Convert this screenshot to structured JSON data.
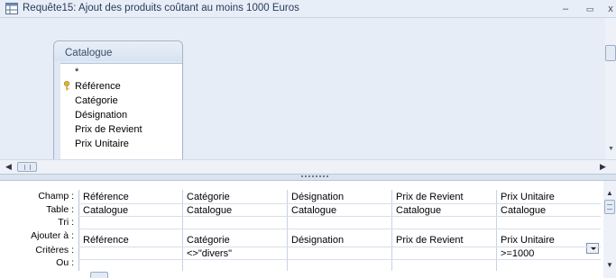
{
  "window": {
    "title": "Requête15: Ajout des produits coûtant au moins 1000 Euros",
    "minimize": "–",
    "restore": "▭",
    "close": "x"
  },
  "table_box": {
    "name": "Catalogue",
    "fields": [
      "*",
      "Référence",
      "Catégorie",
      "Désignation",
      "Prix de Revient",
      "Prix Unitaire"
    ],
    "key_field_index": 1
  },
  "grid": {
    "row_labels": [
      "Champ :",
      "Table :",
      "Tri :",
      "Ajouter à :",
      "Critères :",
      "Ou :"
    ],
    "columns": [
      {
        "champ": "Référence",
        "table": "Catalogue",
        "tri": "",
        "ajouter": "Référence",
        "criteres": "",
        "ou": ""
      },
      {
        "champ": "Catégorie",
        "table": "Catalogue",
        "tri": "",
        "ajouter": "Catégorie",
        "criteres": "<>\"divers\"",
        "ou": ""
      },
      {
        "champ": "Désignation",
        "table": "Catalogue",
        "tri": "",
        "ajouter": "Désignation",
        "criteres": "",
        "ou": ""
      },
      {
        "champ": "Prix de Revient",
        "table": "Catalogue",
        "tri": "",
        "ajouter": "Prix de Revient",
        "criteres": "",
        "ou": ""
      },
      {
        "champ": "Prix Unitaire",
        "table": "Catalogue",
        "tri": "",
        "ajouter": "Prix Unitaire",
        "criteres": ">=1000",
        "ou": ""
      }
    ]
  },
  "icons": {
    "title": "query-design-icon",
    "key": "primary-key-icon",
    "dropdown": "chevron-down-icon"
  },
  "colors": {
    "pane_bg": "#e6edf6",
    "title_text": "#2a3b5a",
    "key": "#d4a51c"
  }
}
